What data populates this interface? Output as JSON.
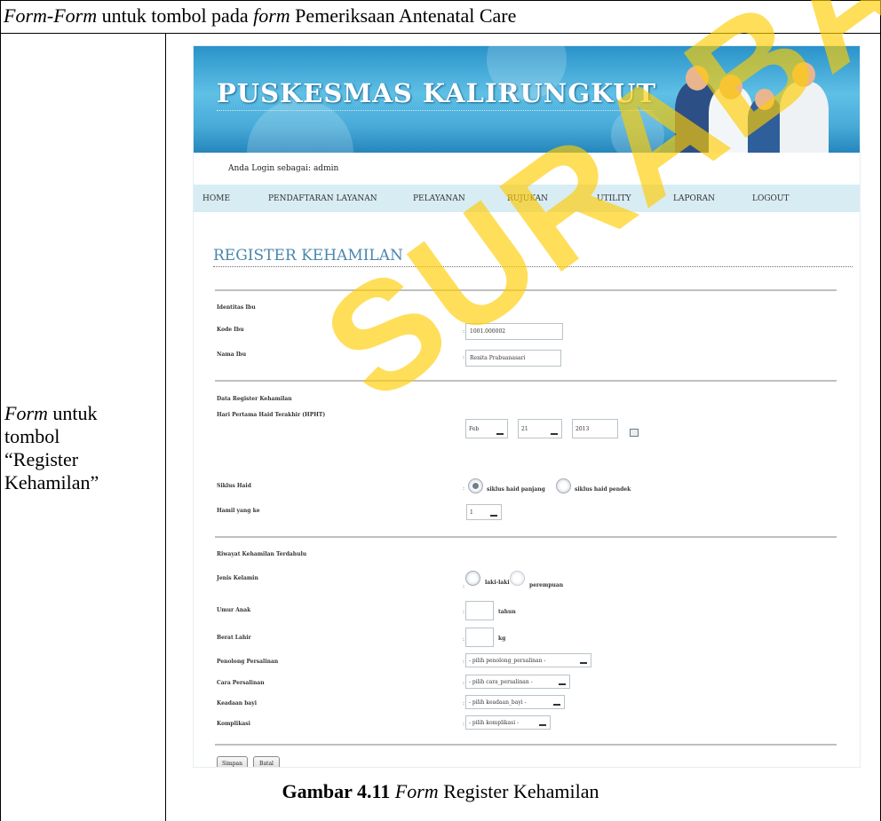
{
  "table": {
    "header_italic_1": "Form-Form",
    "header_plain_1": " untuk tombol pada ",
    "header_italic_2": "form",
    "header_plain_2": " Pemeriksaan Antenatal Care",
    "left_italic": "Form",
    "left_rest_1": " untuk",
    "left_rest_2": "tombol",
    "left_rest_3": "“Register",
    "left_rest_4": "Kehamilan”"
  },
  "app": {
    "banner_title": "PUSKESMAS KALIRUNGKUT",
    "login_text": "Anda Login sebagai: admin",
    "nav": [
      "HOME",
      "PENDAFTARAN LAYANAN",
      "PELAYANAN",
      "RUJUKAN",
      "UTILITY",
      "LAPORAN",
      "LOGOUT"
    ],
    "page_title": "REGISTER KEHAMILAN"
  },
  "form": {
    "section_identitas": "Identitas Ibu",
    "kode_ibu_label": "Kode Ibu",
    "kode_ibu_value": "1001.000002",
    "nama_ibu_label": "Nama Ibu",
    "nama_ibu_value": "Renita Prabuanasari",
    "section_register": "Data Register Kehamilan",
    "hpht_label": "Hari Pertama Haid Terakhir (HPHT)",
    "hpht_month": "Feb",
    "hpht_day": "21",
    "hpht_year": "2013",
    "siklus_label": "Siklus Haid",
    "siklus_opt1": "siklus haid panjang",
    "siklus_opt2": "siklus haid pendek",
    "hamil_label": "Hamil yang ke",
    "hamil_value": "1",
    "section_riwayat": "Riwayat Kehamilan Terdahulu",
    "jk_label": "Jenis Kelamin",
    "jk_opt1": "laki-laki",
    "jk_opt2": "perempuan",
    "umur_label": "Umur Anak",
    "umur_unit": "tahun",
    "berat_label": "Berat Lahir",
    "berat_unit": "kg",
    "penolong_label": "Penolong Persalinan",
    "penolong_value": "- pilih penolong_persalinan -",
    "cara_label": "Cara Persalinan",
    "cara_value": "- pilih cara_persalinan -",
    "keadaan_label": "Keadaan bayi",
    "keadaan_value": "- pilih keadaan_bayi -",
    "komplikasi_label": "Komplikasi",
    "komplikasi_value": "- pilih komplikasi -",
    "simpan_label": "Simpan",
    "batal_label": "Batal"
  },
  "caption": {
    "bold": "Gambar 4.11",
    "italic": "Form",
    "rest": " Register Kehamilan"
  },
  "watermark": "SURABAYA"
}
